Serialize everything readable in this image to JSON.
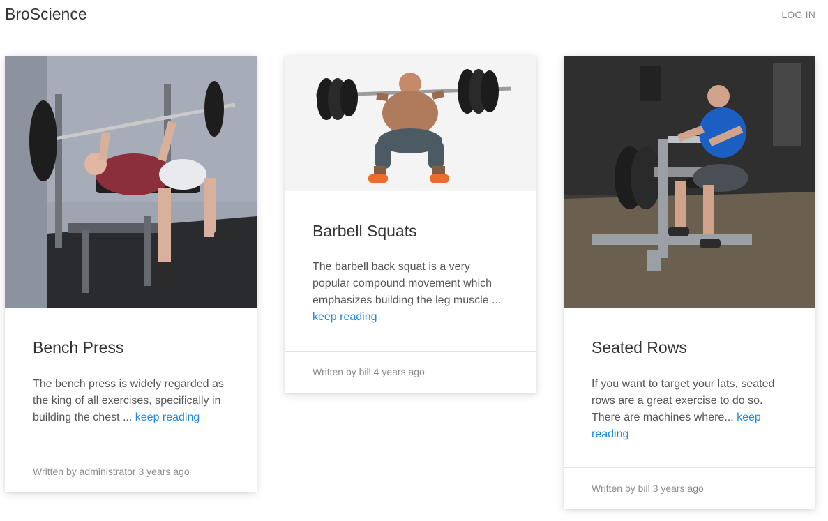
{
  "nav": {
    "brand": "BroScience",
    "login_label": "LOG IN"
  },
  "cards": [
    {
      "title": "Bench Press",
      "excerpt": "The bench press is widely regarded as the king of all exercises, specifically in building the chest ...",
      "link_label": "keep reading",
      "author_line": "Written by administrator 3 years ago",
      "image_alt": "man performing bench press"
    },
    {
      "title": "Barbell Squats",
      "excerpt": "The barbell back squat is a very popular compound movement which emphasizes building the leg muscle ...",
      "link_label": "keep reading",
      "author_line": "Written by bill 4 years ago",
      "image_alt": "man performing barbell squat"
    },
    {
      "title": "Seated Rows",
      "excerpt": "If you want to target your lats, seated rows are a great exercise to do so. There are machines where...",
      "link_label": "keep reading",
      "author_line": "Written by bill 3 years ago",
      "image_alt": "man on seated row machine"
    }
  ]
}
